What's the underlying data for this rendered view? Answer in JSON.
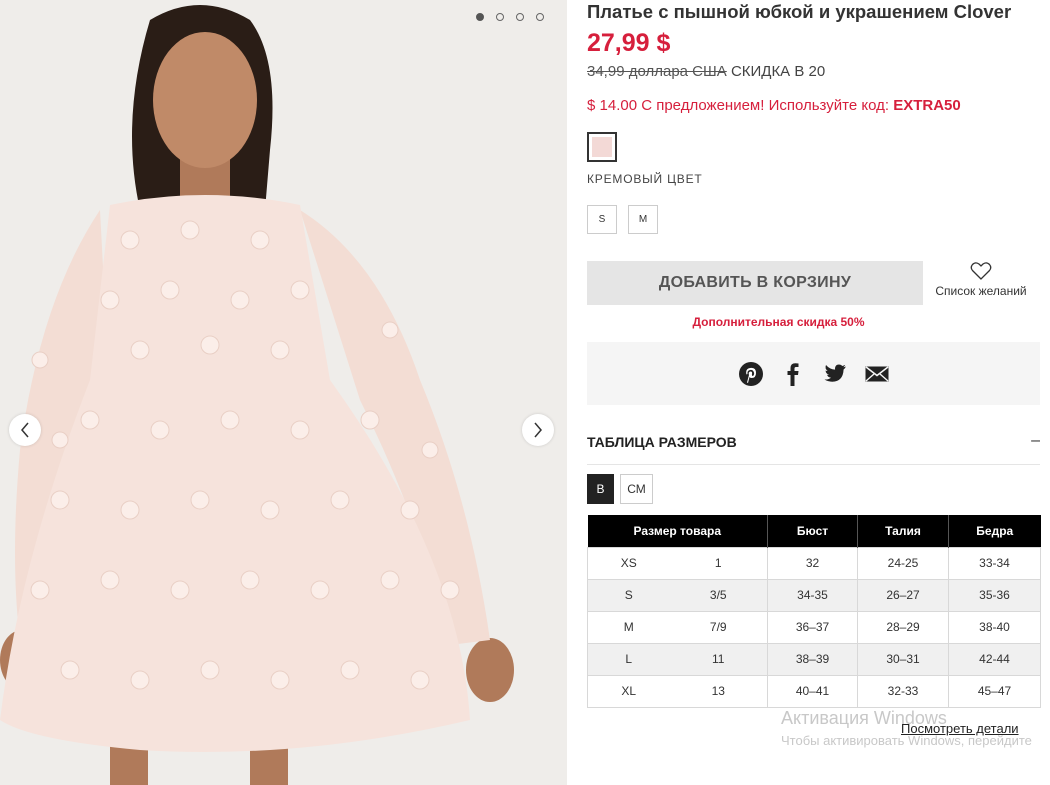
{
  "gallery": {
    "dots": [
      true,
      false,
      false,
      false
    ]
  },
  "product": {
    "title": "Платье с пышной юбкой и украшением Clover",
    "price": "27,99 $",
    "old_price": "34,99 доллара США",
    "discount": "СКИДКА В 20",
    "promo_text": "$ 14.00 С предложением! Используйте код: ",
    "promo_code": "EXTRA50",
    "color_label": "КРЕМОВЫЙ ЦВЕТ",
    "swatch_color": "#f3d9d6",
    "sizes": [
      "S",
      "M"
    ],
    "add_to_cart": "ДОБАВИТЬ В КОРЗИНУ",
    "wishlist": "Список желаний",
    "extra_discount": "Дополнительная скидка 50%"
  },
  "share": {
    "icons": [
      "pinterest-icon",
      "facebook-icon",
      "twitter-icon",
      "email-icon"
    ]
  },
  "size_chart": {
    "heading": "ТАБЛИЦА РАЗМЕРОВ",
    "collapse_symbol": "–",
    "units": [
      "В",
      "СМ"
    ],
    "columns": [
      "Размер товара",
      "Бюст",
      "Талия",
      "Бедра"
    ],
    "rows": [
      [
        "XS",
        "1",
        "32",
        "24-25",
        "33-34"
      ],
      [
        "S",
        "3/5",
        "34-35",
        "26–27",
        "35-36"
      ],
      [
        "M",
        "7/9",
        "36–37",
        "28–29",
        "38-40"
      ],
      [
        "L",
        "11",
        "38–39",
        "30–31",
        "42-44"
      ],
      [
        "XL",
        "13",
        "40–41",
        "32-33",
        "45–47"
      ]
    ]
  },
  "watermark": {
    "title": "Активация Windows",
    "link": "Посмотреть детали",
    "subtitle": "Чтобы активировать Windows, перейдите"
  },
  "colors": {
    "accent_red": "#d61f3c",
    "dress": "#f6e3dc",
    "header_black": "#000000"
  }
}
